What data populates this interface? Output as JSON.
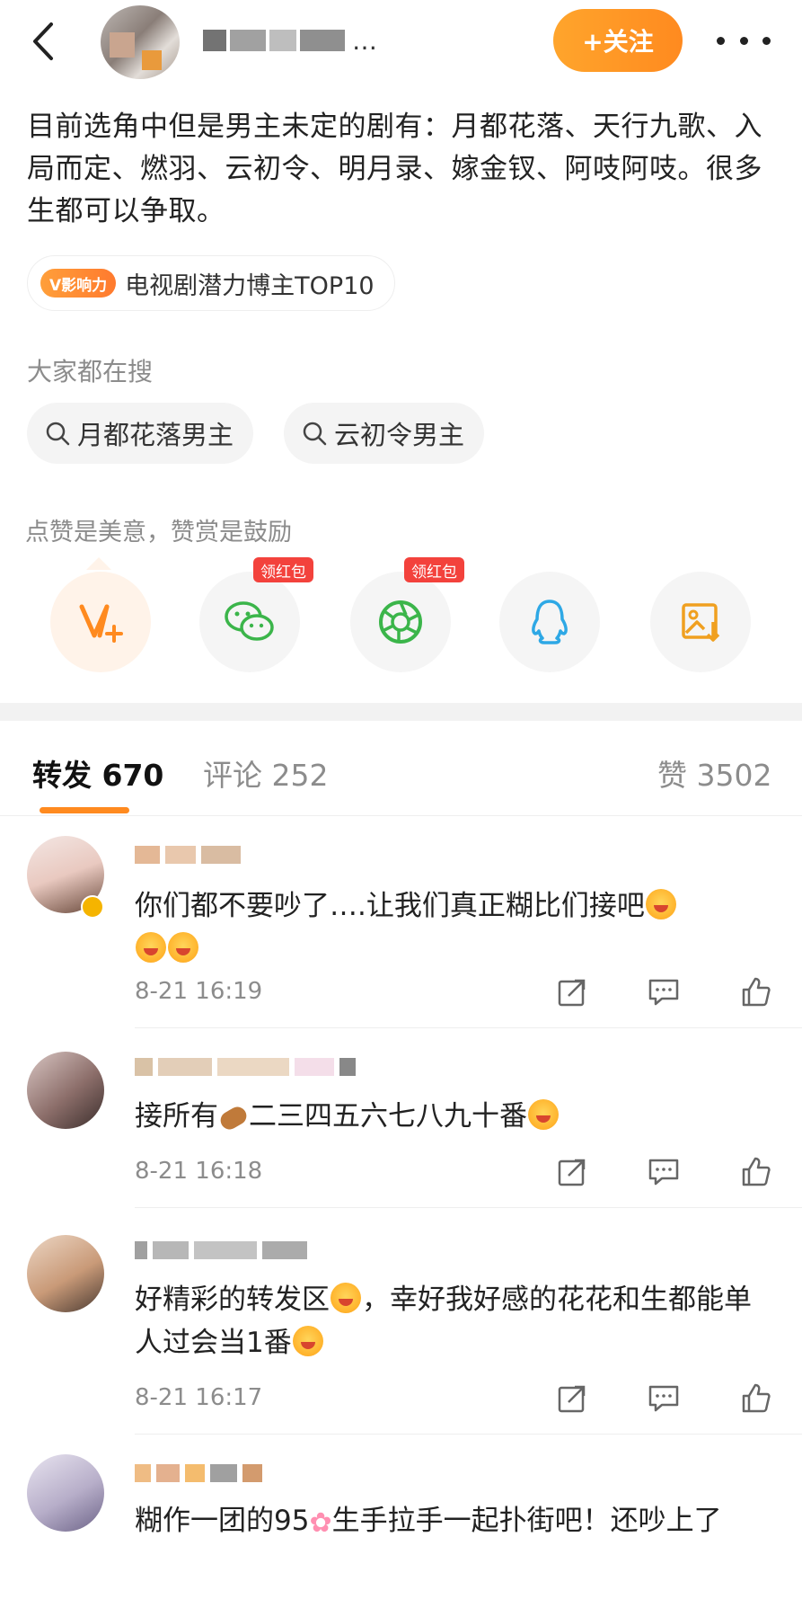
{
  "header": {
    "follow_label": "+关注",
    "username_suffix": "…"
  },
  "post": {
    "text": "目前选角中但是男主未定的剧有：月都花落、天行九歌、入局而定、燃羽、云初令、明月录、嫁金钗、阿吱阿吱。很多生都可以争取。",
    "badge_tag": "V影响力",
    "badge_text": "电视剧潜力博主TOP10"
  },
  "search": {
    "title": "大家都在搜",
    "chips": [
      "月都花落男主",
      "云初令男主"
    ]
  },
  "like_hint": "点赞是美意，赞赏是鼓励",
  "share": {
    "red_packet_label": "领红包",
    "buttons": [
      "v-plus-icon",
      "wechat-icon",
      "moments-icon",
      "qq-icon",
      "save-image-icon"
    ]
  },
  "tabs": {
    "repost": "转发 670",
    "comment": "评论 252",
    "like": "赞 3502"
  },
  "comments": [
    {
      "text": "你们都不要吵了….让我们真正糊比们接吧",
      "time": "8-21 16:19"
    },
    {
      "text_a": "接所有",
      "text_b": "二三四五六七八九十番",
      "time": "8-21 16:18"
    },
    {
      "text_a": "好精彩的转发区",
      "text_b": "，幸好我好感的花花和生都能单人过会当1番",
      "time": "8-21 16:17"
    },
    {
      "text_a": "糊作一团的95",
      "text_b": "生手拉手一起扑街吧！还吵上了"
    }
  ],
  "colors": {
    "accent": "#ff8a1f",
    "muted": "#8c8c8c",
    "red_packet": "#f3423c"
  }
}
